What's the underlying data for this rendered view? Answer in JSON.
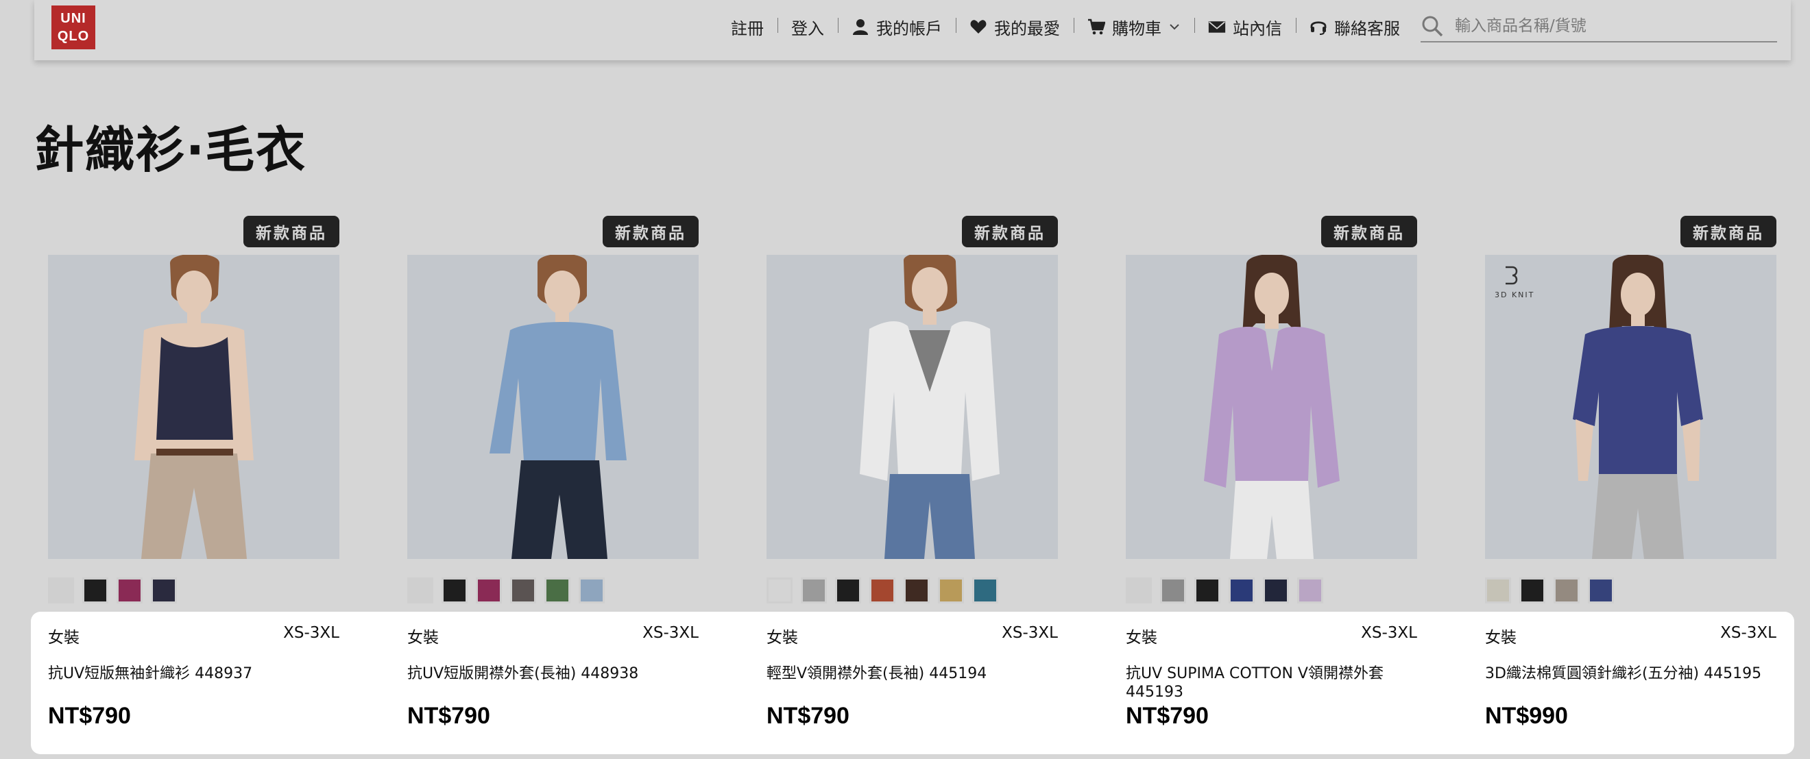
{
  "logo": {
    "line1": "UNI",
    "line2": "QLO"
  },
  "nav": {
    "register": "註冊",
    "login": "登入",
    "account": "我的帳戶",
    "favorites": "我的最愛",
    "cart": "購物車",
    "messages": "站內信",
    "support": "聯絡客服"
  },
  "search": {
    "placeholder": "輸入商品名稱/貨號"
  },
  "page_title": "針織衫‧毛衣",
  "products": [
    {
      "badge": "新款商品",
      "category": "女裝",
      "size": "XS-3XL",
      "name": "抗UV短版無袖針織衫 448937",
      "price": "NT$790",
      "image_icon": "sleeveless-knit-top-model-photo",
      "garment_color": "#2b2d45",
      "swatches": [
        "#cfcfcf",
        "#1e1e1e",
        "#8a2a55",
        "#2a2a3e"
      ]
    },
    {
      "badge": "新款商品",
      "category": "女裝",
      "size": "XS-3XL",
      "name": "抗UV短版開襟外套(長袖) 448938",
      "price": "NT$790",
      "image_icon": "cropped-cardigan-model-photo",
      "garment_color": "#7f9fc4",
      "swatches": [
        "#cfcfcf",
        "#1e1e1e",
        "#8a2a55",
        "#5a5352",
        "#4a6e45",
        "#8ea5be"
      ]
    },
    {
      "badge": "新款商品",
      "category": "女裝",
      "size": "XS-3XL",
      "name": "輕型V領開襟外套(長袖) 445194",
      "price": "NT$790",
      "image_icon": "v-neck-cardigan-model-photo",
      "garment_color": "#e9e9e9",
      "swatches": [
        "#d4d4d4",
        "#9a9a9a",
        "#1e1e1e",
        "#a4472f",
        "#3f2a22",
        "#b89a59",
        "#2e6a80"
      ]
    },
    {
      "badge": "新款商品",
      "category": "女裝",
      "size": "XS-3XL",
      "name": "抗UV SUPIMA COTTON V領開襟外套 445193",
      "price": "NT$790",
      "image_icon": "supima-cotton-cardigan-model-photo",
      "garment_color": "#b59ac8",
      "swatches": [
        "#cfcfcf",
        "#8a8a8a",
        "#1e1e1e",
        "#2a3a78",
        "#22263a",
        "#b9a5c4"
      ]
    },
    {
      "badge": "新款商品",
      "category": "女裝",
      "size": "XS-3XL",
      "name": "3D織法棉質圓領針織衫(五分袖) 445195",
      "price": "NT$990",
      "image_icon": "3d-knit-crew-neck-model-photo",
      "garment_color": "#3b4382",
      "swatches": [
        "#c5c2b6",
        "#1e1e1e",
        "#948a80",
        "#35427a"
      ]
    }
  ]
}
